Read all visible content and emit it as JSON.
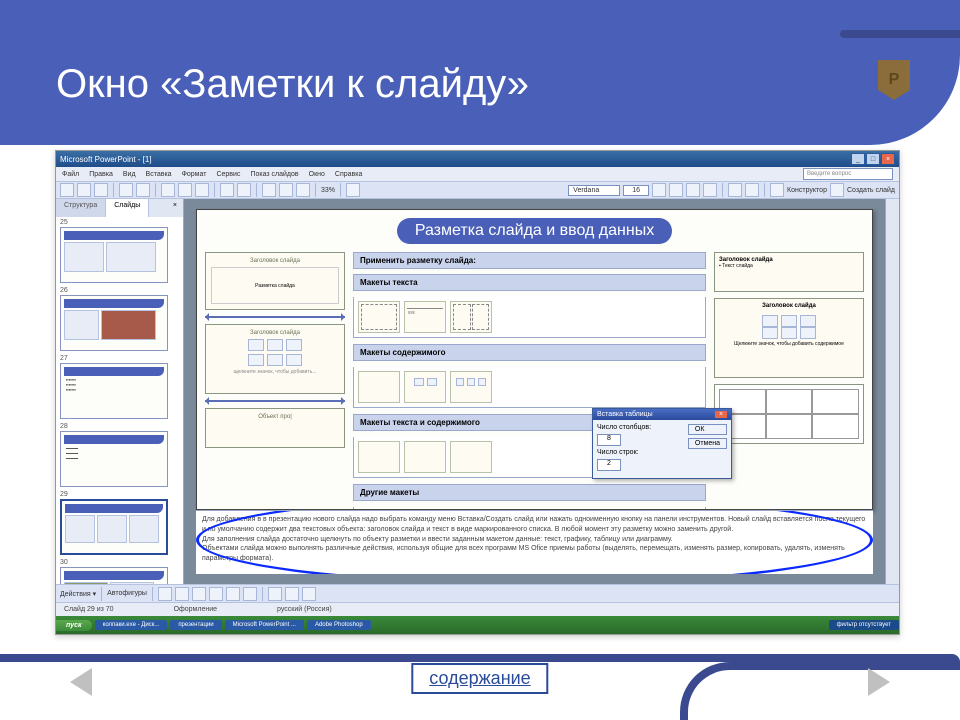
{
  "slide": {
    "title": "Окно «Заметки к слайду»",
    "badge": "P",
    "contents_btn": "содержание"
  },
  "pp": {
    "titlebar": "Microsoft PowerPoint - [1]",
    "menus": [
      "Файл",
      "Правка",
      "Вид",
      "Вставка",
      "Формат",
      "Сервис",
      "Показ слайдов",
      "Окно",
      "Справка"
    ],
    "askbox": "Введите вопрос",
    "zoom": "33%",
    "font": "Verdana",
    "fontsize": "16",
    "tb2_labels": {
      "design": "Конструктор",
      "newslide": "Создать слайд"
    },
    "tabs": {
      "outline": "Структура",
      "slides": "Слайды"
    },
    "thumbs": [
      "25",
      "26",
      "27",
      "28",
      "29",
      "30"
    ],
    "inner_slide": {
      "title": "Разметка  слайда и ввод данных",
      "left_mini": [
        "Заголовок слайда",
        "Разметка слайда",
        "Заголовок слайда",
        "Объект про|"
      ],
      "right_callouts": [
        "Заголовок слайда",
        "Текст слайда",
        "Заголовок слайда",
        "Щелкните значок, чтобы добавить содержимое"
      ],
      "sections": {
        "apply": "Применить разметку слайда:",
        "text": "Макеты текста",
        "content": "Макеты содержимого",
        "textcontent": "Макеты текста и содержимого",
        "other": "Другие макеты"
      }
    },
    "dialog": {
      "title": "Вставка таблицы",
      "cols_label": "Число столбцов:",
      "cols_val": "8",
      "rows_label": "Число строк:",
      "rows_val": "2",
      "ok": "ОК",
      "cancel": "Отмена"
    },
    "notes": {
      "line1": "Для добавления в в презентацию нового слайда надо выбрать команду меню Вставка/Создать слайд или нажать одноименную кнопку на панели инструментов.",
      "line2": "Новый слайд вставляется после текущего и по умолчанию содержит два текстовых объекта: заголовок слайда и текст в виде маркированного списка.",
      "line3": "В любой момент эту разметку можно заменить другой.",
      "line4": "Для заполнения слайда достаточно щелкнуть по объекту разметки и ввести заданным макетом данные: текст, графику, таблицу или диаграмму.",
      "line5": "Объектами слайда можно выполнять различные действия, используя общие для всех программ MS Ofice приемы работы (выделять, перемещать, изменять размер, копировать, удалять, изменять параметры формата)."
    },
    "draw_label": "Автофигуры",
    "status": {
      "slide_of": "Слайд 29 из 70",
      "lang": "русский (Россия)",
      "mid": "Оформление"
    },
    "taskbar": {
      "start": "пуск",
      "items": [
        "колпаки.exe - Диск...",
        "презентации",
        "Microsoft PowerPoint ...",
        "Adobe Photoshop"
      ],
      "tray": "фильтр отсутствует"
    }
  }
}
